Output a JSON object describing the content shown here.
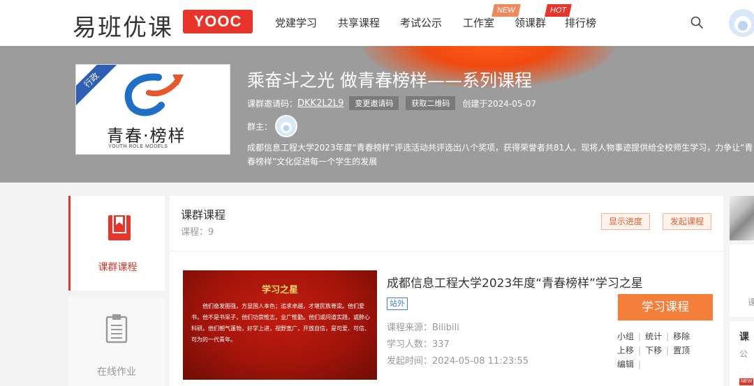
{
  "header": {
    "logo_text": "易班优课",
    "logo_badge": "YOOC",
    "nav": [
      {
        "label": "党建学习"
      },
      {
        "label": "共享课程"
      },
      {
        "label": "考试公示"
      },
      {
        "label": "工作室",
        "tag": "NEW"
      },
      {
        "label": "领课群",
        "tag": "HOT"
      },
      {
        "label": "排行榜"
      }
    ]
  },
  "banner": {
    "cover_ribbon": "行政",
    "cover_title": "青春·榜样",
    "cover_subtitle": "YOUTH ROLE MODELS",
    "title": "乘奋斗之光 做青春榜样——系列课程",
    "invite_label": "课群邀请码：",
    "invite_code": "DKK2L2L9",
    "change_code_btn": "变更邀请码",
    "qr_btn": "获取二维码",
    "created": "创建于2024-05-07",
    "owner_label": "群主：",
    "description": "成都信息工程大学2023年度“青春榜样”评选活动共评选出八个奖项，获得荣誉者共81人。现将人物事迹提供给全校师生学习，力争让“青春榜样”文化促进每一个学生的发展"
  },
  "sidebar": {
    "items": [
      {
        "label": "课群课程"
      },
      {
        "label": "在线作业"
      }
    ]
  },
  "main": {
    "title": "课群课程",
    "count": "课程：9",
    "show_progress_btn": "显示进度",
    "start_course_btn": "发起课程",
    "course": {
      "thumb_title": "学习之星",
      "thumb_text": "他们奋发图强，方显国人本色；追求卓越，才堪民族脊梁。他们爱书，他不是书呆子，他们功崇惟志，业广惟勤。他们或问道实践，或醉心科研。他们朝气蓬勃，好学上进，视野宽广，开放自信，是可爱、可信、可为的一代青年。",
      "title": "成都信息工程大学2023年度“青春榜样”学习之星",
      "tag": "站外",
      "source": "课程来源：Bilibili",
      "learners": "学习人数：337",
      "start_time": "发起时间：2024-05-08 11:23:55",
      "study_btn": "学习课程",
      "ops": [
        [
          "小组",
          "统计",
          "移除"
        ],
        [
          "上移",
          "下移",
          "置顶"
        ],
        [
          "编辑"
        ]
      ]
    }
  },
  "right_col": {
    "text1": "课",
    "text2": "课",
    "text3": "公",
    "badge": "NEW"
  },
  "colors": {
    "brand_red": "#e8352c",
    "accent_orange": "#f47f3a",
    "banner_gray": "#9c9c9c"
  }
}
